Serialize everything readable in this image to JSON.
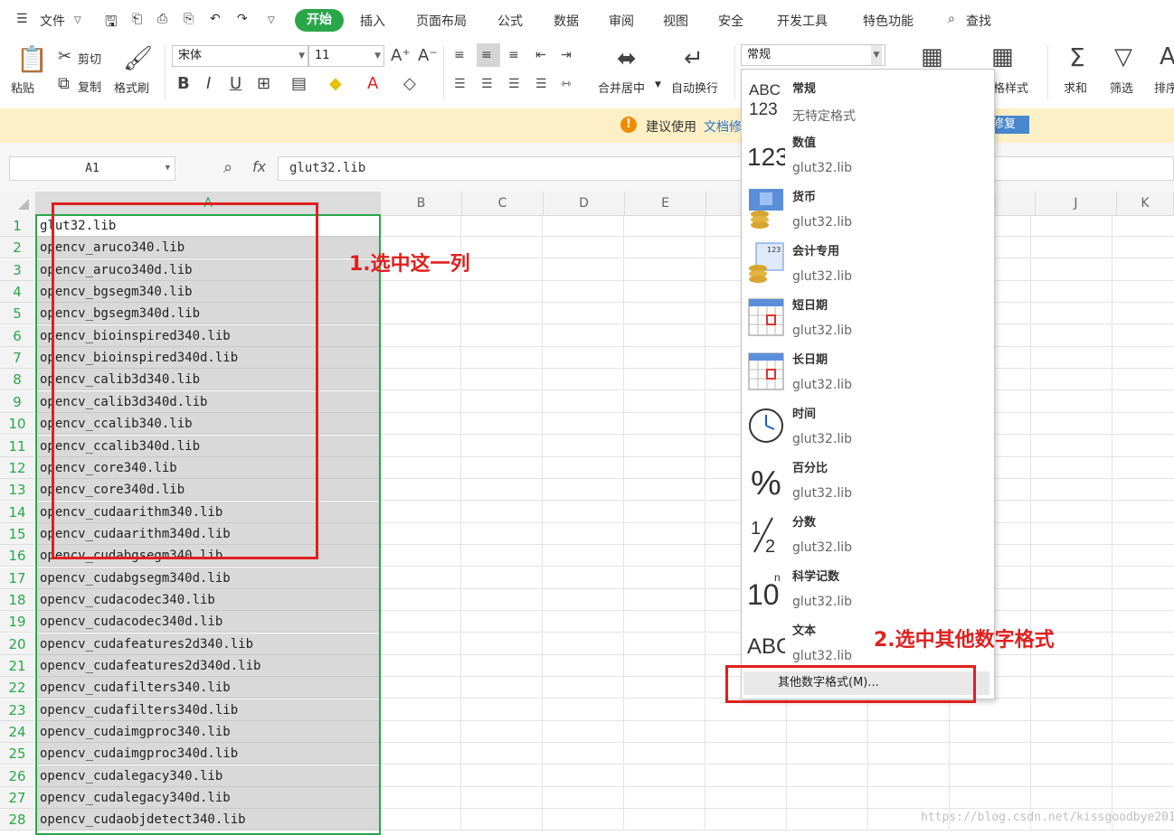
{
  "menubar": {
    "file": "文件",
    "tabs": [
      "开始",
      "插入",
      "页面布局",
      "公式",
      "数据",
      "审阅",
      "视图",
      "安全",
      "开发工具",
      "特色功能"
    ],
    "search": "查找"
  },
  "ribbon": {
    "paste": "粘贴",
    "cut": "剪切",
    "copy": "复制",
    "format_painter": "格式刷",
    "font_name": "宋体",
    "font_size": "11",
    "merge_center": "合并居中",
    "wrap_text": "自动换行",
    "number_format": "常规",
    "table_style": "格样式",
    "sum": "求和",
    "filter": "筛选",
    "sort": "排序"
  },
  "notice": {
    "text": "建议使用",
    "link": "文档修",
    "repair_button": "修复"
  },
  "formula_bar": {
    "cell_ref": "A1",
    "fx": "fx",
    "value": "glut32.lib"
  },
  "columns": [
    "A",
    "B",
    "C",
    "D",
    "E",
    "",
    "",
    "",
    "",
    "I",
    "J",
    "K"
  ],
  "rows": [
    "glut32.lib",
    "opencv_aruco340.lib",
    "opencv_aruco340d.lib",
    "opencv_bgsegm340.lib",
    "opencv_bgsegm340d.lib",
    "opencv_bioinspired340.lib",
    "opencv_bioinspired340d.lib",
    "opencv_calib3d340.lib",
    "opencv_calib3d340d.lib",
    "opencv_ccalib340.lib",
    "opencv_ccalib340d.lib",
    "opencv_core340.lib",
    "opencv_core340d.lib",
    "opencv_cudaarithm340.lib",
    "opencv_cudaarithm340d.lib",
    "opencv_cudabgsegm340.lib",
    "opencv_cudabgsegm340d.lib",
    "opencv_cudacodec340.lib",
    "opencv_cudacodec340d.lib",
    "opencv_cudafeatures2d340.lib",
    "opencv_cudafeatures2d340d.lib",
    "opencv_cudafilters340.lib",
    "opencv_cudafilters340d.lib",
    "opencv_cudaimgproc340.lib",
    "opencv_cudaimgproc340d.lib",
    "opencv_cudalegacy340.lib",
    "opencv_cudalegacy340d.lib",
    "opencv_cudaobjdetect340.lib"
  ],
  "annotations": {
    "step1": "1.选中这一列",
    "step2": "2.选中其他数字格式"
  },
  "dropdown": {
    "formats": [
      {
        "name": "常规",
        "sample": "无特定格式",
        "icon": "general-format-icon"
      },
      {
        "name": "数值",
        "sample": "glut32.lib",
        "icon": "number-format-icon"
      },
      {
        "name": "货币",
        "sample": "glut32.lib",
        "icon": "currency-format-icon"
      },
      {
        "name": "会计专用",
        "sample": "glut32.lib",
        "icon": "accounting-format-icon"
      },
      {
        "name": "短日期",
        "sample": "glut32.lib",
        "icon": "short-date-icon"
      },
      {
        "name": "长日期",
        "sample": "glut32.lib",
        "icon": "long-date-icon"
      },
      {
        "name": "时间",
        "sample": "glut32.lib",
        "icon": "clock-icon"
      },
      {
        "name": "百分比",
        "sample": "glut32.lib",
        "icon": "percent-icon"
      },
      {
        "name": "分数",
        "sample": "glut32.lib",
        "icon": "fraction-icon"
      },
      {
        "name": "科学记数",
        "sample": "glut32.lib",
        "icon": "scientific-icon"
      },
      {
        "name": "文本",
        "sample": "glut32.lib",
        "icon": "text-format-icon"
      }
    ],
    "other": "其他数字格式(M)..."
  },
  "watermark": "https://blog.csdn.net/kissgoodbye2012"
}
